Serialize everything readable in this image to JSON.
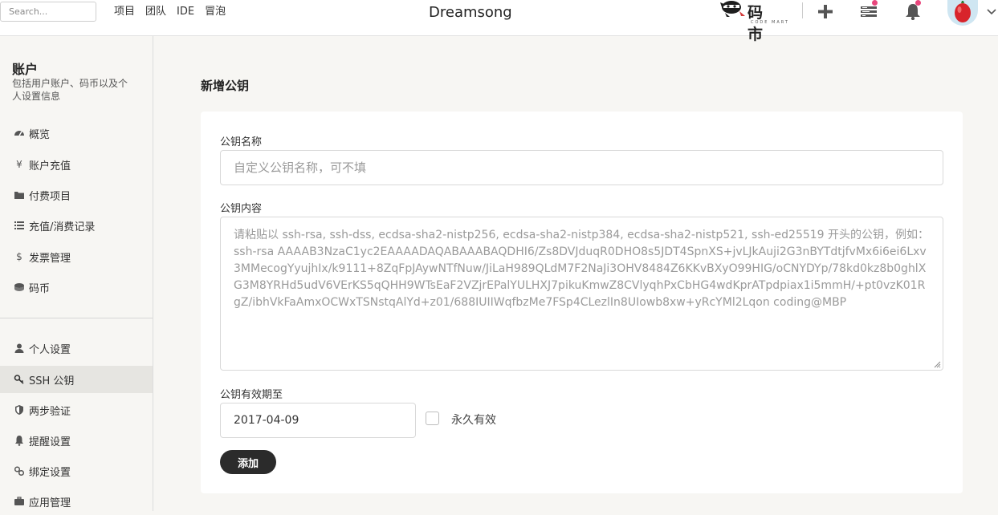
{
  "header": {
    "search_placeholder": "Search...",
    "nav": [
      "项目",
      "团队",
      "IDE",
      "冒泡"
    ],
    "app_title": "Dreamsong",
    "logo_text": "码 市",
    "logo_sub": "CODE MART",
    "icons": [
      "plus-icon",
      "task-list-icon",
      "bell-icon",
      "avatar",
      "chevron-down-icon"
    ],
    "notify_color": "#e8467c"
  },
  "sidebar": {
    "title": "账户",
    "description": "包括用户账户、码币以及个人设置信息",
    "items": [
      {
        "label": "概览",
        "icon": "dashboard-icon"
      },
      {
        "label": "账户充值",
        "icon": "yen-icon"
      },
      {
        "label": "付费项目",
        "icon": "folder-icon"
      },
      {
        "label": "充值/消费记录",
        "icon": "list-icon"
      },
      {
        "label": "发票管理",
        "icon": "dollar-icon"
      },
      {
        "label": "码币",
        "icon": "coins-icon"
      },
      {
        "label": "个人设置",
        "icon": "user-icon"
      },
      {
        "label": "SSH 公钥",
        "icon": "key-icon",
        "active": true
      },
      {
        "label": "两步验证",
        "icon": "shield-icon"
      },
      {
        "label": "提醒设置",
        "icon": "bell-icon"
      },
      {
        "label": "绑定设置",
        "icon": "link-icon"
      },
      {
        "label": "应用管理",
        "icon": "briefcase-icon"
      }
    ]
  },
  "main": {
    "title": "新增公钥",
    "name_label": "公钥名称",
    "name_placeholder": "自定义公钥名称，可不填",
    "content_label": "公钥内容",
    "content_placeholder": "请粘贴以 ssh-rsa, ssh-dss, ecdsa-sha2-nistp256, ecdsa-sha2-nistp384, ecdsa-sha2-nistp521, ssh-ed25519 开头的公钥，例如：ssh-rsa AAAAB3NzaC1yc2EAAAADAQABAAABAQDHI6/Zs8DVJduqR0DHO8s5JDT4SpnXS+jvLJkAuji2G3nBYTdtjfvMx6i6ei6Lxv3MMecogYyujhIx/k9111+8ZqFpJAywNTfNuw/JiLaH989QLdM7F2NaJi3OHV8484Z6KKvBXyO99HIG/oCNYDYp/78kd0kz8b0ghlXG3M8YRHd5udV6VErKS5qQHH9WTsEaF2VZjrEPalYULHXJ7pikuKmwZ8CVlyqhPxCbHG4wdKprATpdpiax1i5mmH/+pt0vzK01RgZ/ibhVkFaAmxOCWxTSNstqAlYd+z01/688IUIIWqfbzMe7FSp4CLezlIn8UIowb8xw+yRcYMl2Lqon coding@MBP",
    "expire_label": "公钥有效期至",
    "expire_value": "2017-04-09",
    "forever_label": "永久有效",
    "add_button": "添加"
  }
}
